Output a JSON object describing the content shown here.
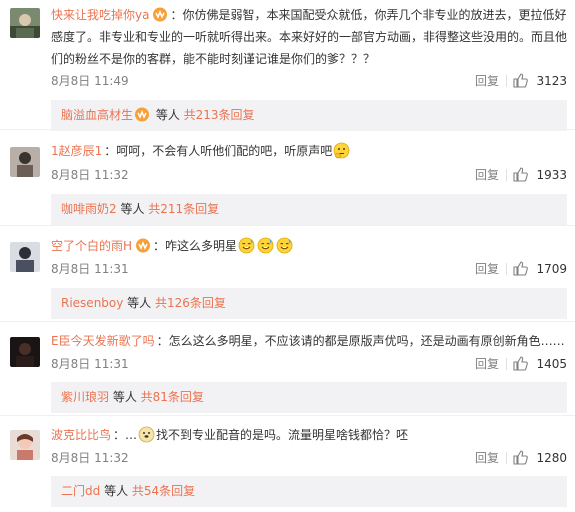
{
  "colors": {
    "accent": "#eb7350",
    "meta": "#808080",
    "subreply_bg": "#f2f2f5"
  },
  "comments": [
    {
      "username": "快来让我吃掉你ya",
      "has_vip_badge": true,
      "text_lines": [
        "：你仿佛是弱智，本来国配受众就低，你弄几个非专业的放进去，更拉低好",
        "感度了。非专业和专业的一听就听得出来。本来好好的一部官方动画，非得整这些没用的。而且他",
        "们的粉丝不是你的客群，能不能时刻谨记谁是你们的爹？？？"
      ],
      "time": "8月8日 11:49",
      "reply_label": "回复",
      "like_count": "3123",
      "sub": {
        "user": "脑溢血高材生",
        "has_vip_badge": true,
        "middle": " 等人 ",
        "total": "共213条回复"
      }
    },
    {
      "username": "1赵彦辰1",
      "has_vip_badge": false,
      "text_lines": [
        "：呵呵，不会有人听他们配的吧，听原声吧"
      ],
      "emoji_after": "thinking-emoji",
      "time": "8月8日 11:32",
      "reply_label": "回复",
      "like_count": "1933",
      "sub": {
        "user": "咖啡雨奶2",
        "has_vip_badge": false,
        "middle": " 等人 ",
        "total": "共211条回复"
      }
    },
    {
      "username": "空了个白的雨H",
      "has_vip_badge": true,
      "text_lines": [
        "：咋这么多明星"
      ],
      "emoji_count": 3,
      "time": "8月8日 11:31",
      "reply_label": "回复",
      "like_count": "1709",
      "sub": {
        "user": "Riesenboy",
        "has_vip_badge": false,
        "middle": " 等人 ",
        "total": "共126条回复"
      }
    },
    {
      "username": "E臣今天发新歌了吗",
      "has_vip_badge": false,
      "text_lines": [
        "：怎么这么多明星，不应该请的都是原版声优吗，还是动画有原创新角色……"
      ],
      "time": "8月8日 11:31",
      "reply_label": "回复",
      "like_count": "1405",
      "sub": {
        "user": "紫川琅羽",
        "has_vip_badge": false,
        "middle": " 等人 ",
        "total": "共81条回复"
      }
    },
    {
      "username": "波克比比鸟",
      "has_vip_badge": false,
      "text_lines": [
        "：…",
        "找不到专业配音的是吗。流量明星啥钱都恰？呸"
      ],
      "time": "8月8日 11:32",
      "reply_label": "回复",
      "like_count": "1280",
      "sub": {
        "user": "二门dd",
        "has_vip_badge": false,
        "middle": " 等人 ",
        "total": "共54条回复"
      }
    }
  ]
}
